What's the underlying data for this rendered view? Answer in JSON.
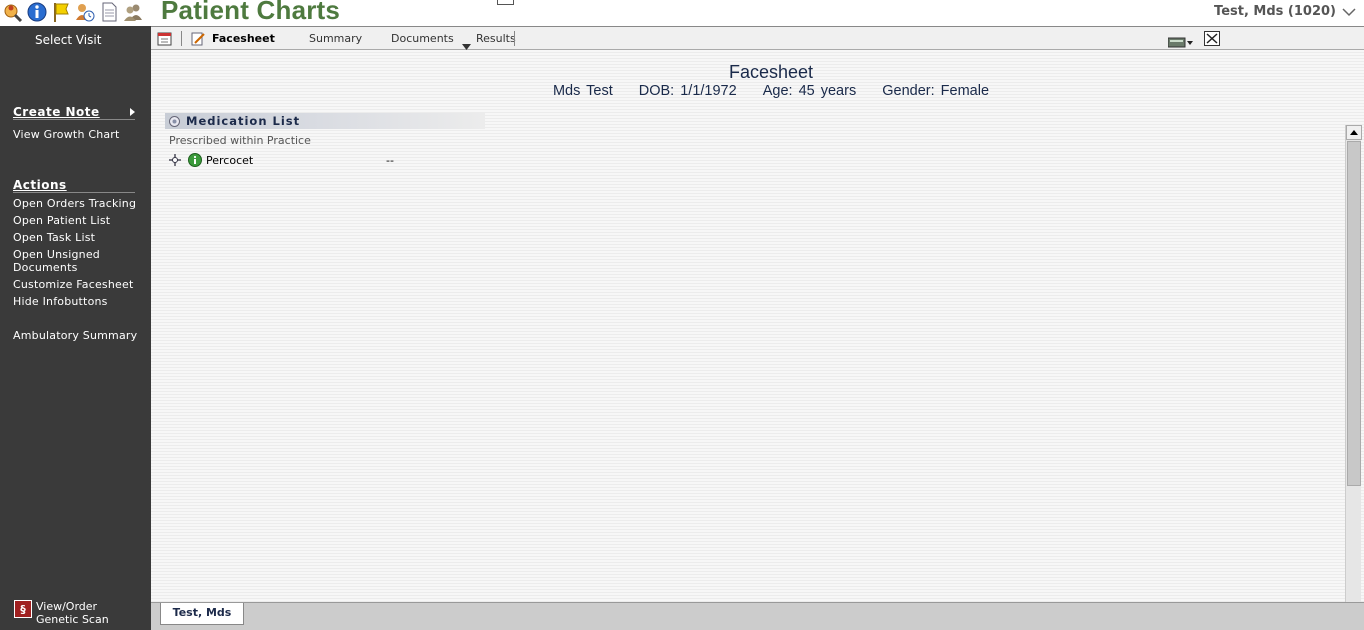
{
  "header": {
    "app_title": "Patient Charts",
    "patient_selector": "Test, Mds (1020)",
    "icons": [
      "search-person-icon",
      "info-icon",
      "flag-icon",
      "user-clock-icon",
      "document-icon",
      "users-icon"
    ]
  },
  "sidebar": {
    "select_visit": "Select Visit",
    "create_note": "Create Note",
    "view_growth_chart": "View Growth Chart",
    "actions_header": "Actions",
    "actions": [
      "Open Orders Tracking",
      "Open Patient List",
      "Open Task List",
      "Open Unsigned Documents",
      "Customize Facesheet",
      "Hide Infobuttons"
    ],
    "ambulatory_summary": "Ambulatory Summary",
    "genetic_scan": "View/Order Genetic Scan"
  },
  "toolbar": {
    "tabs": [
      "Facesheet",
      "Summary",
      "Documents",
      "Results"
    ]
  },
  "facesheet": {
    "title": "Facesheet",
    "patient_name": "Mds Test",
    "dob": "DOB: 1/1/1972",
    "age": "Age: 45 years",
    "gender": "Gender: Female"
  },
  "medication_list": {
    "title": "Medication List",
    "subtitle": "Prescribed within Practice",
    "items": [
      {
        "name": "Percocet",
        "value": "--"
      }
    ]
  },
  "bottom_tabs": [
    "Test, Mds"
  ],
  "colors": {
    "title_green": "#4e7a3f",
    "sidebar_bg": "#3a3a3a",
    "navy_text": "#1c2a4a"
  }
}
